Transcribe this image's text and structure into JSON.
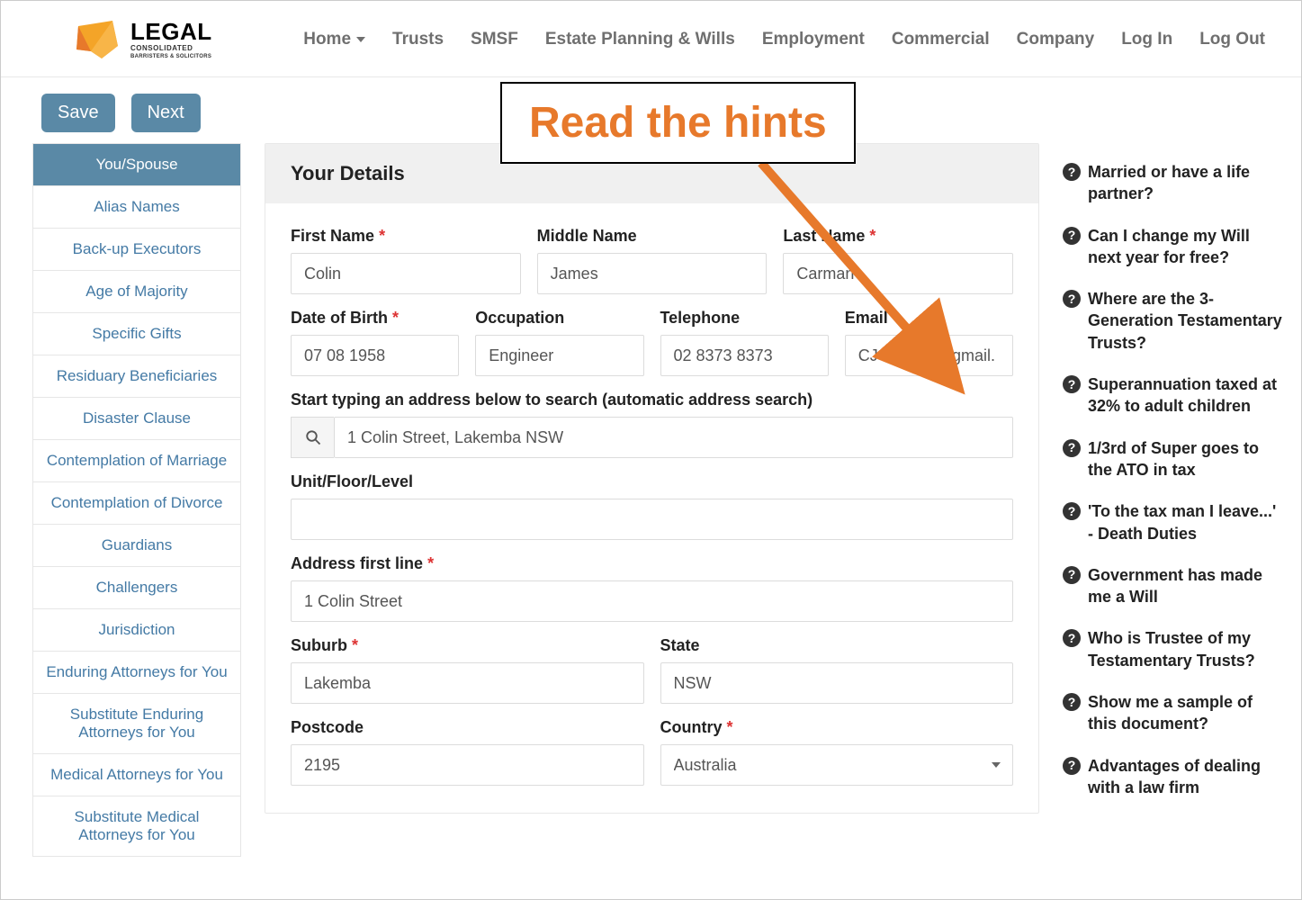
{
  "logo": {
    "top": "LEGAL",
    "sub": "CONSOLIDATED",
    "tag": "BARRISTERS & SOLICITORS"
  },
  "nav": {
    "home": "Home",
    "trusts": "Trusts",
    "smsf": "SMSF",
    "estate": "Estate Planning & Wills",
    "employment": "Employment",
    "commercial": "Commercial",
    "company": "Company",
    "login": "Log In",
    "logout": "Log Out"
  },
  "actions": {
    "save": "Save",
    "next": "Next"
  },
  "sidebar": [
    "You/Spouse",
    "Alias Names",
    "Back-up Executors",
    "Age of Majority",
    "Specific Gifts",
    "Residuary Beneficiaries",
    "Disaster Clause",
    "Contemplation of Marriage",
    "Contemplation of Divorce",
    "Guardians",
    "Challengers",
    "Jurisdiction",
    "Enduring Attorneys for You",
    "Substitute Enduring Attorneys for You",
    "Medical Attorneys for You",
    "Substitute Medical Attorneys for You"
  ],
  "form": {
    "title": "Your Details",
    "labels": {
      "first_name": "First Name",
      "middle_name": "Middle Name",
      "last_name": "Last Name",
      "dob": "Date of Birth",
      "occupation": "Occupation",
      "telephone": "Telephone",
      "email": "Email",
      "search_hint": "Start typing an address below to search (automatic address search)",
      "unit": "Unit/Floor/Level",
      "addr1": "Address first line",
      "suburb": "Suburb",
      "state": "State",
      "postcode": "Postcode",
      "country": "Country"
    },
    "values": {
      "first_name": "Colin",
      "middle_name": "James",
      "last_name": "Carman",
      "dob": "07 08 1958",
      "occupation": "Engineer",
      "telephone": "02 8373 8373",
      "email": "CJCarman@gmail.",
      "search": "1 Colin Street, Lakemba NSW",
      "unit": "",
      "addr1": "1 Colin Street",
      "suburb": "Lakemba",
      "state": "NSW",
      "postcode": "2195",
      "country": "Australia"
    }
  },
  "hints": [
    "Married or have a life partner?",
    "Can I change my Will next year for free?",
    "Where are the 3-Generation Testamentary Trusts?",
    "Superannuation taxed at 32% to adult children",
    "1/3rd of Super goes to the ATO in tax",
    "'To the tax man I leave...' - Death Duties",
    "Government has made me a Will",
    "Who is Trustee of my Testamentary Trusts?",
    "Show me a sample of this document?",
    "Advantages of dealing with a law firm"
  ],
  "callout": "Read the hints",
  "asterisk": "*"
}
